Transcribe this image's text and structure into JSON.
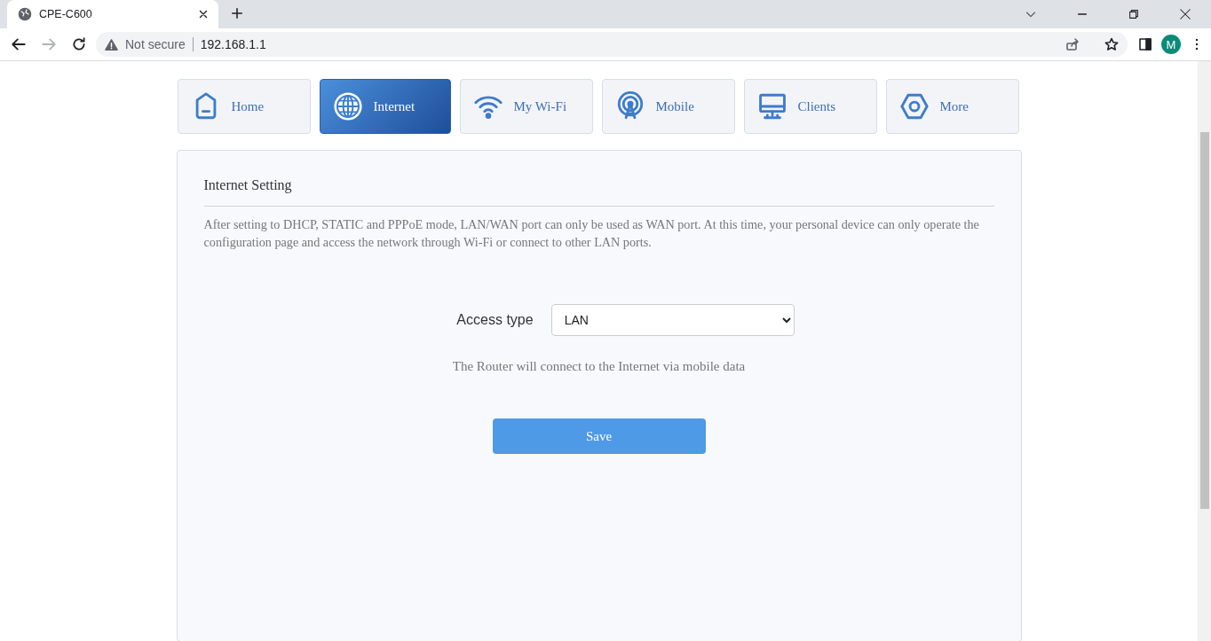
{
  "browser": {
    "tab_title": "CPE-C600",
    "security": "Not secure",
    "address": "192.168.1.1",
    "profile_initial": "M"
  },
  "tabs": [
    {
      "label": "Home",
      "selected": false
    },
    {
      "label": "Internet",
      "selected": true
    },
    {
      "label": "My Wi-Fi",
      "selected": false
    },
    {
      "label": "Mobile",
      "selected": false
    },
    {
      "label": "Clients",
      "selected": false
    },
    {
      "label": "More",
      "selected": false
    }
  ],
  "panel": {
    "title": "Internet Setting",
    "description": "After setting to DHCP, STATIC and PPPoE mode, LAN/WAN port can only be used as WAN port. At this time, your personal device can only operate the configuration page and access the network through Wi-Fi or connect to other LAN ports.",
    "access_type": {
      "label": "Access type",
      "value": "LAN"
    },
    "hint": "The Router will connect to the Internet via mobile data",
    "save_button": "Save"
  }
}
